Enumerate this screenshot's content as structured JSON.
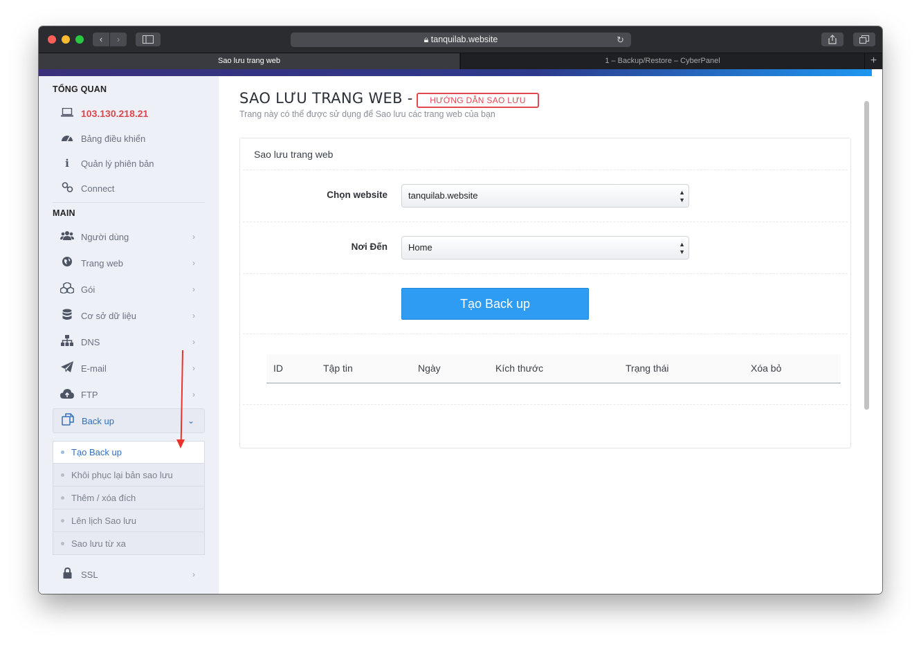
{
  "browser": {
    "url": "tanquilab.website",
    "tabs": [
      {
        "label": "Sao lưu trang web",
        "active": true
      },
      {
        "label": "1 – Backup/Restore – CyberPanel",
        "active": false
      }
    ]
  },
  "sidebar": {
    "section_overview": "TỔNG QUAN",
    "ip": "103.130.218.21",
    "overview_items": [
      {
        "label": "Bảng điều khiển",
        "icon": "dashboard-icon"
      },
      {
        "label": "Quản lý phiên bản",
        "icon": "info-icon"
      },
      {
        "label": "Connect",
        "icon": "link-icon"
      }
    ],
    "section_main": "MAIN",
    "main_items": [
      {
        "label": "Người dùng",
        "icon": "users-icon"
      },
      {
        "label": "Trang web",
        "icon": "globe-icon"
      },
      {
        "label": "Gói",
        "icon": "cubes-icon"
      },
      {
        "label": "Cơ sở dữ liệu",
        "icon": "database-icon"
      },
      {
        "label": "DNS",
        "icon": "sitemap-icon"
      },
      {
        "label": "E-mail",
        "icon": "paper-plane-icon"
      },
      {
        "label": "FTP",
        "icon": "cloud-upload-icon"
      }
    ],
    "backup": {
      "label": "Back up",
      "icon": "copy-icon"
    },
    "backup_sub": [
      {
        "label": "Tạo Back up",
        "active": true
      },
      {
        "label": "Khôi phục lại bản sao lưu",
        "active": false
      },
      {
        "label": "Thêm / xóa đích",
        "active": false
      },
      {
        "label": "Lên lịch Sao lưu",
        "active": false
      },
      {
        "label": "Sao lưu từ xa",
        "active": false
      }
    ],
    "ssl": {
      "label": "SSL",
      "icon": "lock-icon"
    }
  },
  "main": {
    "title": "SAO LƯU TRANG WEB -",
    "guide_button": "HƯỚNG DẪN SAO LƯU",
    "subtitle": "Trang này có thể được sử dụng để Sao lưu các trang web của bạn",
    "card_title": "Sao lưu trang web",
    "website_label": "Chọn website",
    "website_value": "tanquilab.website",
    "destination_label": "Nơi Đến",
    "destination_value": "Home",
    "create_button": "Tạo Back up",
    "table_headers": [
      "ID",
      "Tập tin",
      "Ngày",
      "Kích thước",
      "Trạng thái",
      "Xóa bỏ"
    ]
  },
  "colors": {
    "accent_blue": "#2e9cf3",
    "danger_red": "#e0474f",
    "annotation_arrow": "#e8322b"
  }
}
